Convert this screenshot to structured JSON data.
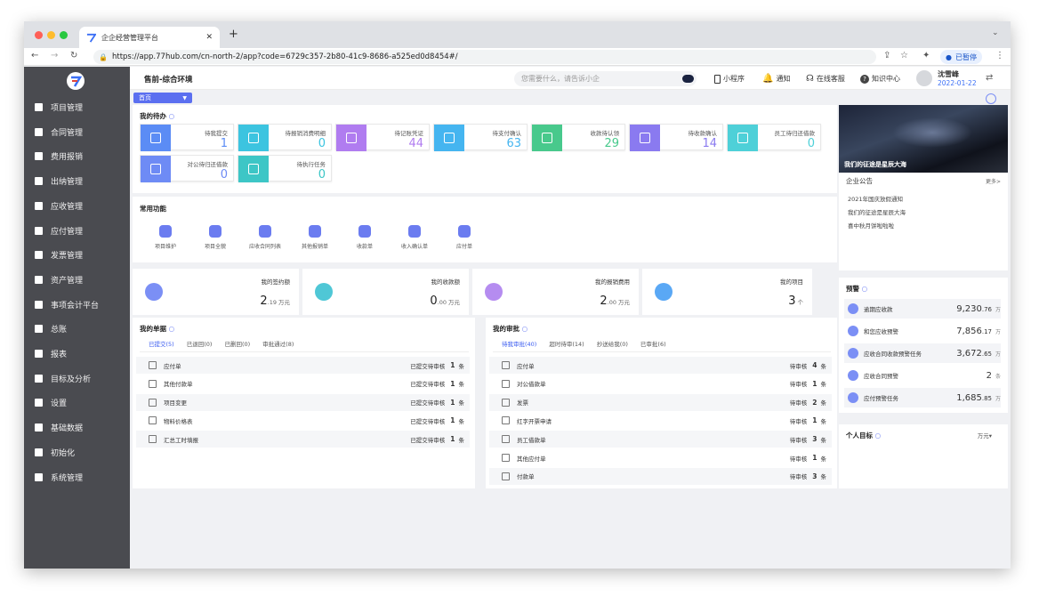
{
  "browser": {
    "tab_title": "企企经营管理平台",
    "new_tab": "+",
    "url": "https://app.77hub.com/cn-north-2/app?code=6729c357-2b80-41c9-8686-a525ed0d8454#/",
    "paused_label": "已暂停"
  },
  "sidebar": {
    "items": [
      {
        "label": "项目管理"
      },
      {
        "label": "合同管理"
      },
      {
        "label": "费用报销"
      },
      {
        "label": "出纳管理"
      },
      {
        "label": "应收管理"
      },
      {
        "label": "应付管理"
      },
      {
        "label": "发票管理"
      },
      {
        "label": "资产管理"
      },
      {
        "label": "事项会计平台"
      },
      {
        "label": "总账"
      },
      {
        "label": "报表"
      },
      {
        "label": "目标及分析"
      },
      {
        "label": "设置"
      },
      {
        "label": "基础数据"
      },
      {
        "label": "初始化"
      },
      {
        "label": "系统管理"
      }
    ]
  },
  "topbar": {
    "env": "售前-综合环境",
    "search_placeholder": "您需要什么，请告诉小企",
    "mini_program": "小程序",
    "notify": "通知",
    "online_service": "在线客服",
    "knowledge": "知识中心",
    "user_name": "沈雪峰",
    "date": "2022-01-22"
  },
  "home_tab": "首页",
  "todo": {
    "title": "我的待办",
    "items": [
      {
        "label": "待我提交",
        "value": "1",
        "color": "#5b8cf5"
      },
      {
        "label": "待报销消费明细",
        "value": "0",
        "color": "#3cc4e0"
      },
      {
        "label": "待记账凭证",
        "value": "44",
        "color": "#b07cf0"
      },
      {
        "label": "待支付确认",
        "value": "63",
        "color": "#45b5f0"
      },
      {
        "label": "收款待认领",
        "value": "29",
        "color": "#48c98c"
      },
      {
        "label": "待收款确认",
        "value": "14",
        "color": "#8a7af0"
      },
      {
        "label": "员工待归还借款",
        "value": "0",
        "color": "#4ed0d8"
      },
      {
        "label": "对公待归还借款",
        "value": "0",
        "color": "#6e8bf5"
      },
      {
        "label": "待执行任务",
        "value": "0",
        "color": "#3dc6c6"
      }
    ]
  },
  "functions": {
    "title": "常用功能",
    "items": [
      {
        "label": "项目维护"
      },
      {
        "label": "项目全貌"
      },
      {
        "label": "应收合同列表"
      },
      {
        "label": "其他报销单"
      },
      {
        "label": "收款单"
      },
      {
        "label": "收入确认单"
      },
      {
        "label": "应付单"
      }
    ]
  },
  "stats": [
    {
      "label": "我的签约额",
      "value": "2",
      "decimal": ".19",
      "unit": "万元",
      "color": "#7b8ff5"
    },
    {
      "label": "我的收款额",
      "value": "0",
      "decimal": ".00",
      "unit": "万元",
      "color": "#4fc7d6"
    },
    {
      "label": "我的报销费用",
      "value": "2",
      "decimal": ".00",
      "unit": "万元",
      "color": "#b58cf0"
    },
    {
      "label": "我的项目",
      "value": "3",
      "decimal": "",
      "unit": "个",
      "color": "#5aa8f5"
    }
  ],
  "my_docs": {
    "title": "我的单据",
    "tabs": [
      "已提交(5)",
      "已退回(0)",
      "已删回(0)",
      "审批通过(8)"
    ],
    "rows": [
      {
        "name": "应付单",
        "status": "已提交待审核",
        "count": "1",
        "unit": "条"
      },
      {
        "name": "其他付款单",
        "status": "已提交待审核",
        "count": "1",
        "unit": "条"
      },
      {
        "name": "项目变更",
        "status": "已提交待审核",
        "count": "1",
        "unit": "条"
      },
      {
        "name": "物料价格表",
        "status": "已提交待审核",
        "count": "1",
        "unit": "条"
      },
      {
        "name": "汇总工时填报",
        "status": "已提交待审核",
        "count": "1",
        "unit": "条"
      }
    ]
  },
  "my_approvals": {
    "title": "我的审批",
    "tabs": [
      "待我审批(40)",
      "超时待审(14)",
      "抄送给我(0)",
      "已审批(6)"
    ],
    "rows": [
      {
        "name": "应付单",
        "status": "待审核",
        "count": "4",
        "unit": "条"
      },
      {
        "name": "对公借款单",
        "status": "待审核",
        "count": "1",
        "unit": "条"
      },
      {
        "name": "发票",
        "status": "待审核",
        "count": "2",
        "unit": "条"
      },
      {
        "name": "红字开票申请",
        "status": "待审核",
        "count": "1",
        "unit": "条"
      },
      {
        "name": "员工借款单",
        "status": "待审核",
        "count": "3",
        "unit": "条"
      },
      {
        "name": "其他应付单",
        "status": "待审核",
        "count": "1",
        "unit": "条"
      },
      {
        "name": "付款单",
        "status": "待审核",
        "count": "3",
        "unit": "条"
      }
    ]
  },
  "banner": {
    "caption": "我们的征途是星辰大海"
  },
  "notice": {
    "title": "企业公告",
    "more": "更多>",
    "items": [
      "2021年国庆放假通知",
      "我们的征途是星辰大海",
      "喜中秋月饼啦啦啦"
    ]
  },
  "warnings": {
    "title": "预警",
    "items": [
      {
        "name": "逾期应收款",
        "value": "9,230",
        "decimal": ".76",
        "unit": "万"
      },
      {
        "name": "和您应收预警",
        "value": "7,856",
        "decimal": ".17",
        "unit": "万"
      },
      {
        "name": "应收合同收款预警任务",
        "value": "3,672",
        "decimal": ".65",
        "unit": "万"
      },
      {
        "name": "应收合同预警",
        "value": "2",
        "decimal": "",
        "unit": "条"
      },
      {
        "name": "应付预警任务",
        "value": "1,685",
        "decimal": ".85",
        "unit": "万"
      }
    ]
  },
  "personal_goal": {
    "title": "个人目标",
    "unit_select": "万元▾"
  }
}
